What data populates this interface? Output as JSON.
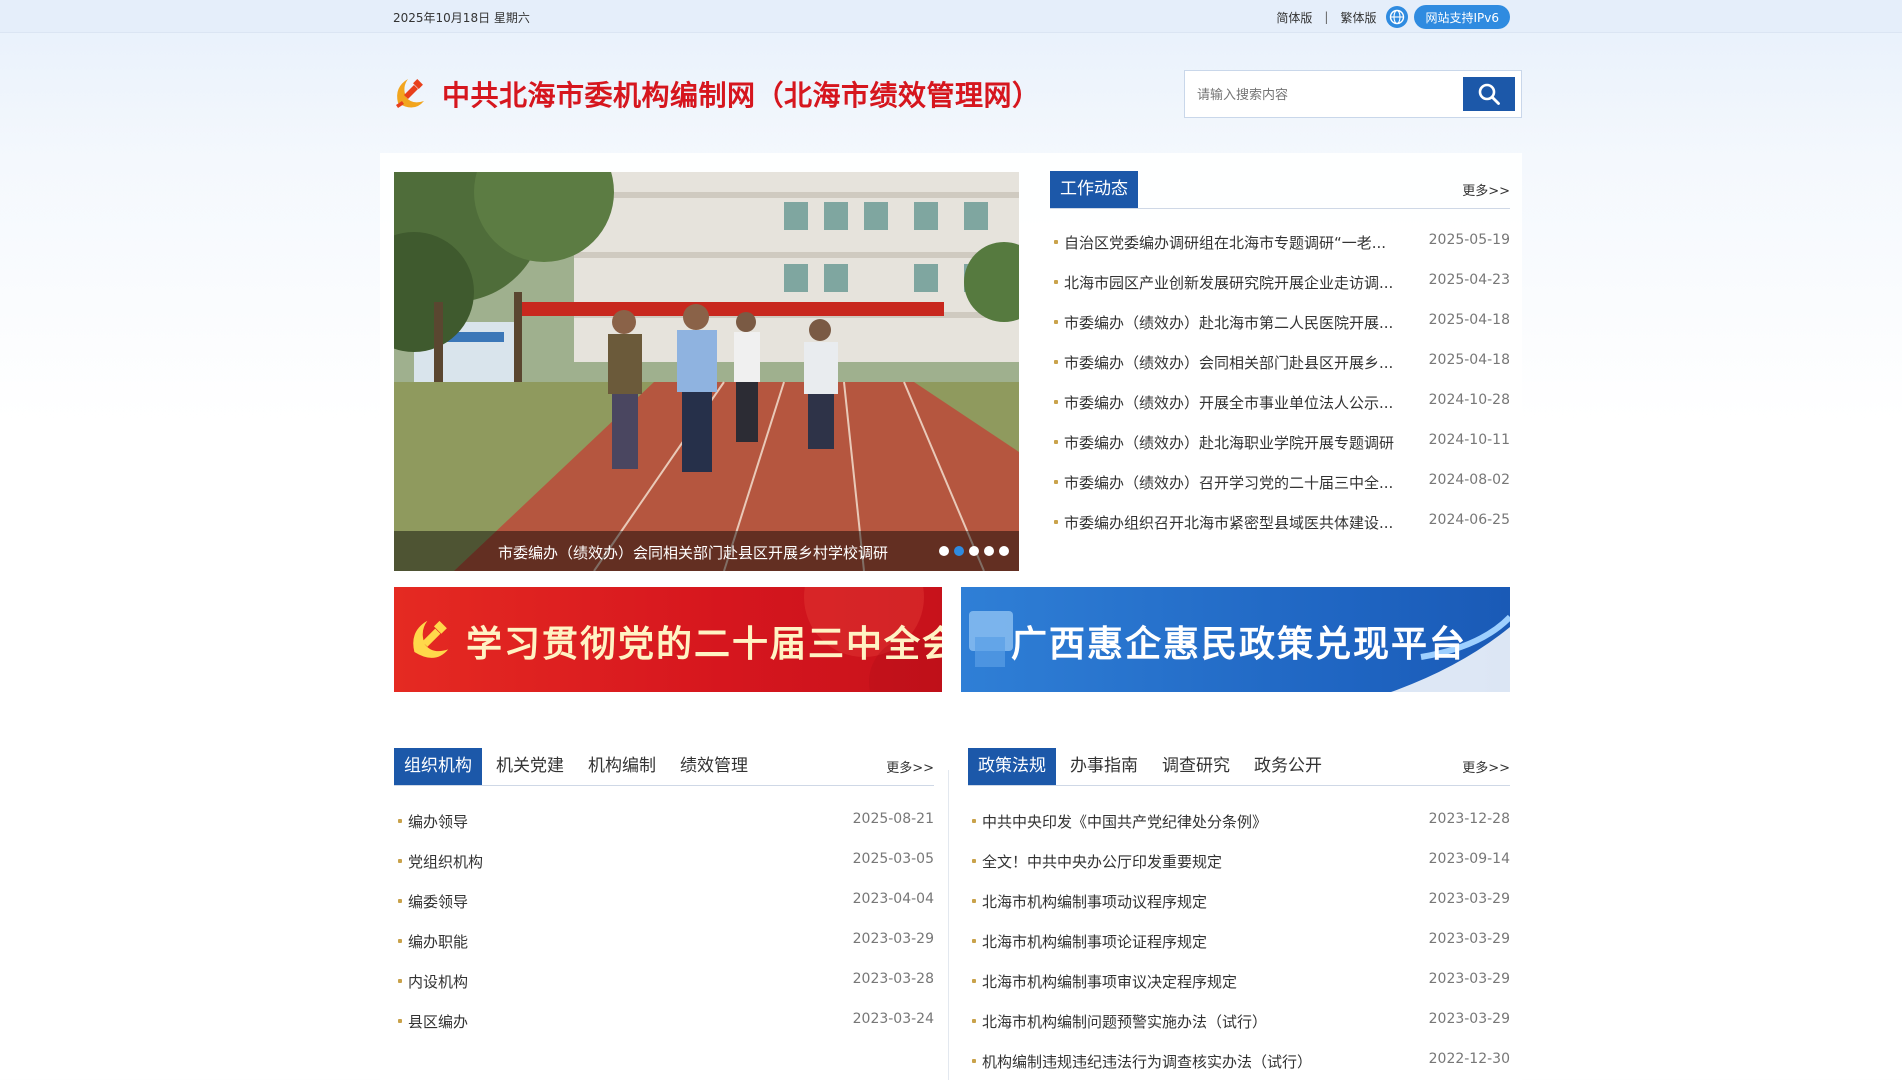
{
  "topbar": {
    "date": "2025年10月18日 星期六",
    "simplified": "简体版",
    "separator": "|",
    "traditional": "繁体版",
    "ipv6": "网站支持IPv6"
  },
  "header": {
    "title": "中共北海市委机构编制网（北海市绩效管理网）",
    "search_placeholder": "请输入搜索内容"
  },
  "carousel": {
    "caption": "市委编办（绩效办）会同相关部门赴县区开展乡村学校调研",
    "dots": 5,
    "active_dot": 2
  },
  "work_news": {
    "tab": "工作动态",
    "more": "更多>>",
    "items": [
      {
        "title": "自治区党委编办调研组在北海市专题调研“一老...",
        "date": "2025-05-19"
      },
      {
        "title": "北海市园区产业创新发展研究院开展企业走访调...",
        "date": "2025-04-23"
      },
      {
        "title": "市委编办（绩效办）赴北海市第二人民医院开展...",
        "date": "2025-04-18"
      },
      {
        "title": "市委编办（绩效办）会同相关部门赴县区开展乡...",
        "date": "2025-04-18"
      },
      {
        "title": "市委编办（绩效办）开展全市事业单位法人公示...",
        "date": "2024-10-28"
      },
      {
        "title": "市委编办（绩效办）赴北海职业学院开展专题调研",
        "date": "2024-10-11"
      },
      {
        "title": "市委编办（绩效办）召开学习党的二十届三中全...",
        "date": "2024-08-02"
      },
      {
        "title": "市委编办组织召开北海市紧密型县域医共体建设...",
        "date": "2024-06-25"
      }
    ]
  },
  "banners": {
    "left": "学习贯彻党的二十届三中全会精神",
    "right": "广西惠企惠民政策兑现平台"
  },
  "org_section": {
    "tabs": [
      "组织机构",
      "机关党建",
      "机构编制",
      "绩效管理"
    ],
    "more": "更多>>",
    "items": [
      {
        "title": "编办领导",
        "date": "2025-08-21"
      },
      {
        "title": "党组织机构",
        "date": "2025-03-05"
      },
      {
        "title": "编委领导",
        "date": "2023-04-04"
      },
      {
        "title": "编办职能",
        "date": "2023-03-29"
      },
      {
        "title": "内设机构",
        "date": "2023-03-28"
      },
      {
        "title": "县区编办",
        "date": "2023-03-24"
      }
    ]
  },
  "policy_section": {
    "tabs": [
      "政策法规",
      "办事指南",
      "调查研究",
      "政务公开"
    ],
    "more": "更多>>",
    "items": [
      {
        "title": "中共中央印发《中国共产党纪律处分条例》",
        "date": "2023-12-28"
      },
      {
        "title": "全文！中共中央办公厅印发重要规定",
        "date": "2023-09-14"
      },
      {
        "title": "北海市机构编制事项动议程序规定",
        "date": "2023-03-29"
      },
      {
        "title": "北海市机构编制事项论证程序规定",
        "date": "2023-03-29"
      },
      {
        "title": "北海市机构编制事项审议决定程序规定",
        "date": "2023-03-29"
      },
      {
        "title": "北海市机构编制问题预警实施办法（试行）",
        "date": "2023-03-29"
      },
      {
        "title": "机构编制违规违纪违法行为调查核实办法（试行）",
        "date": "2022-12-30"
      }
    ]
  },
  "colors": {
    "brand_red": "#d6161e",
    "brand_blue": "#1c58a9",
    "accent_blue": "#2f8be0"
  }
}
